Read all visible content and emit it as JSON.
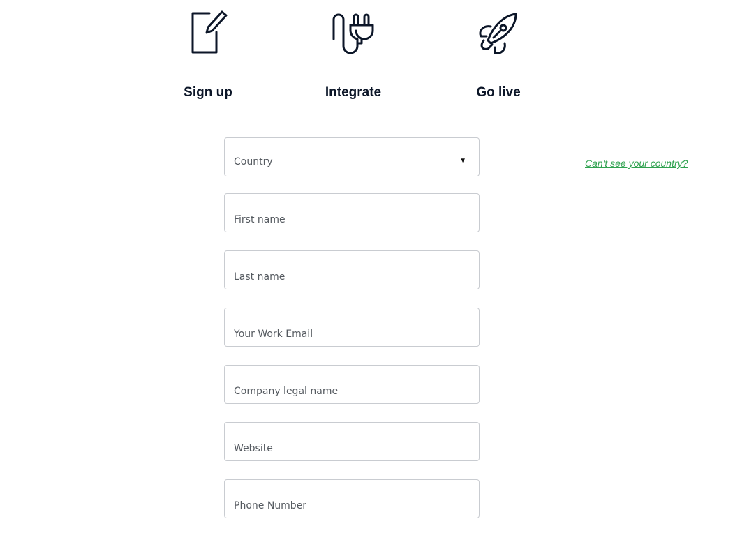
{
  "steps": [
    {
      "label": "Sign up",
      "icon": "notepad-pencil-icon"
    },
    {
      "label": "Integrate",
      "icon": "plug-icon"
    },
    {
      "label": "Go live",
      "icon": "rocket-icon"
    }
  ],
  "form": {
    "country": {
      "placeholder": "Country",
      "caret": "▼"
    },
    "cant_see_country_link": "Can't see your country?",
    "fields": [
      {
        "name": "first-name",
        "placeholder": "First name"
      },
      {
        "name": "last-name",
        "placeholder": "Last name"
      },
      {
        "name": "work-email",
        "placeholder": "Your Work Email"
      },
      {
        "name": "company-legal-name",
        "placeholder": "Company legal name"
      },
      {
        "name": "website",
        "placeholder": "Website"
      },
      {
        "name": "phone-number",
        "placeholder": "Phone Number"
      }
    ]
  }
}
